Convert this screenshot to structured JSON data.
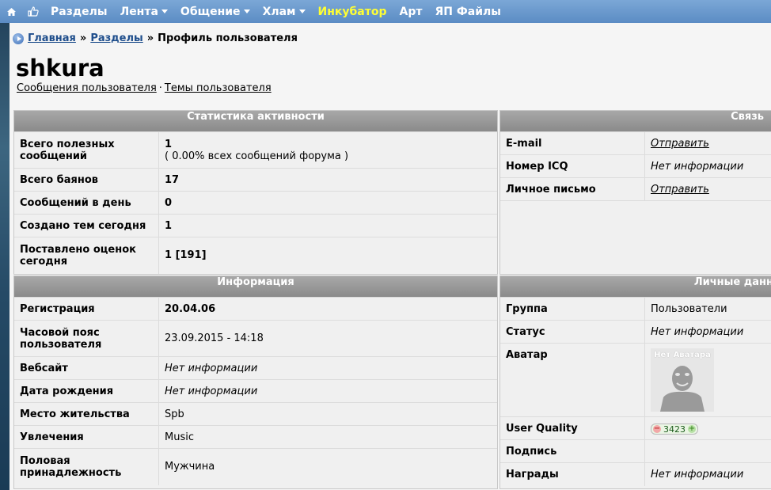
{
  "nav": {
    "items": [
      {
        "label": "Разделы",
        "dropdown": false
      },
      {
        "label": "Лента",
        "dropdown": true
      },
      {
        "label": "Общение",
        "dropdown": true
      },
      {
        "label": "Хлам",
        "dropdown": true
      },
      {
        "label": "Инкубатор",
        "dropdown": false,
        "highlight": true
      },
      {
        "label": "Арт",
        "dropdown": false
      },
      {
        "label": "ЯП Файлы",
        "dropdown": false
      }
    ],
    "icons": [
      "home-icon",
      "thumbs-up-icon"
    ]
  },
  "breadcrumb": {
    "home": "Главная",
    "sections": "Разделы",
    "current": "Профиль пользователя",
    "separator": "»"
  },
  "profile": {
    "username": "shkura",
    "links": {
      "messages": "Сообщения пользователя",
      "dot": "·",
      "topics": "Темы пользователя"
    }
  },
  "activity": {
    "title": "Статистика активности",
    "rows": [
      {
        "label": "Всего полезных сообщений",
        "value": "1",
        "sub": "( 0.00% всех сообщений форума )"
      },
      {
        "label": "Всего баянов",
        "value": "17"
      },
      {
        "label": "Сообщений в день",
        "value": "0"
      },
      {
        "label": "Создано тем сегодня",
        "value": "1"
      },
      {
        "label": "Поставлено оценок сегодня",
        "value": "1 [191]"
      }
    ]
  },
  "contact": {
    "title": "Связь",
    "rows": [
      {
        "label": "E-mail",
        "value": "Отправить",
        "link": true
      },
      {
        "label": "Номер ICQ",
        "value": "Нет информации",
        "link": false
      },
      {
        "label": "Личное письмо",
        "value": "Отправить",
        "link": true
      }
    ]
  },
  "info": {
    "title": "Информация",
    "rows": [
      {
        "label": "Регистрация",
        "value": "20.04.06"
      },
      {
        "label": "Часовой пояс пользователя",
        "value": "23.09.2015 - 14:18"
      },
      {
        "label": "Вебсайт",
        "value": "Нет информации"
      },
      {
        "label": "Дата рождения",
        "value": "Нет информации"
      },
      {
        "label": "Место жительства",
        "value": "Spb"
      },
      {
        "label": "Увлечения",
        "value": "Music"
      },
      {
        "label": "Половая принадлежность",
        "value": "Мужчина"
      }
    ]
  },
  "personal": {
    "title": "Личные данн",
    "rows": [
      {
        "label": "Группа",
        "value": "Пользователи"
      },
      {
        "label": "Статус",
        "value": "Нет информации"
      },
      {
        "label": "Аватар",
        "avatar_text": "Нет Аватара"
      },
      {
        "label": "User Quality",
        "quality": "3423",
        "minus": "−",
        "plus": "+"
      },
      {
        "label": "Подпись",
        "value": ""
      },
      {
        "label": "Награды",
        "value": "Нет информации"
      }
    ]
  },
  "colors": {
    "nav_bg": "#6a99cd",
    "highlight": "#ffff33",
    "panel_header": "#9a9a9a"
  }
}
